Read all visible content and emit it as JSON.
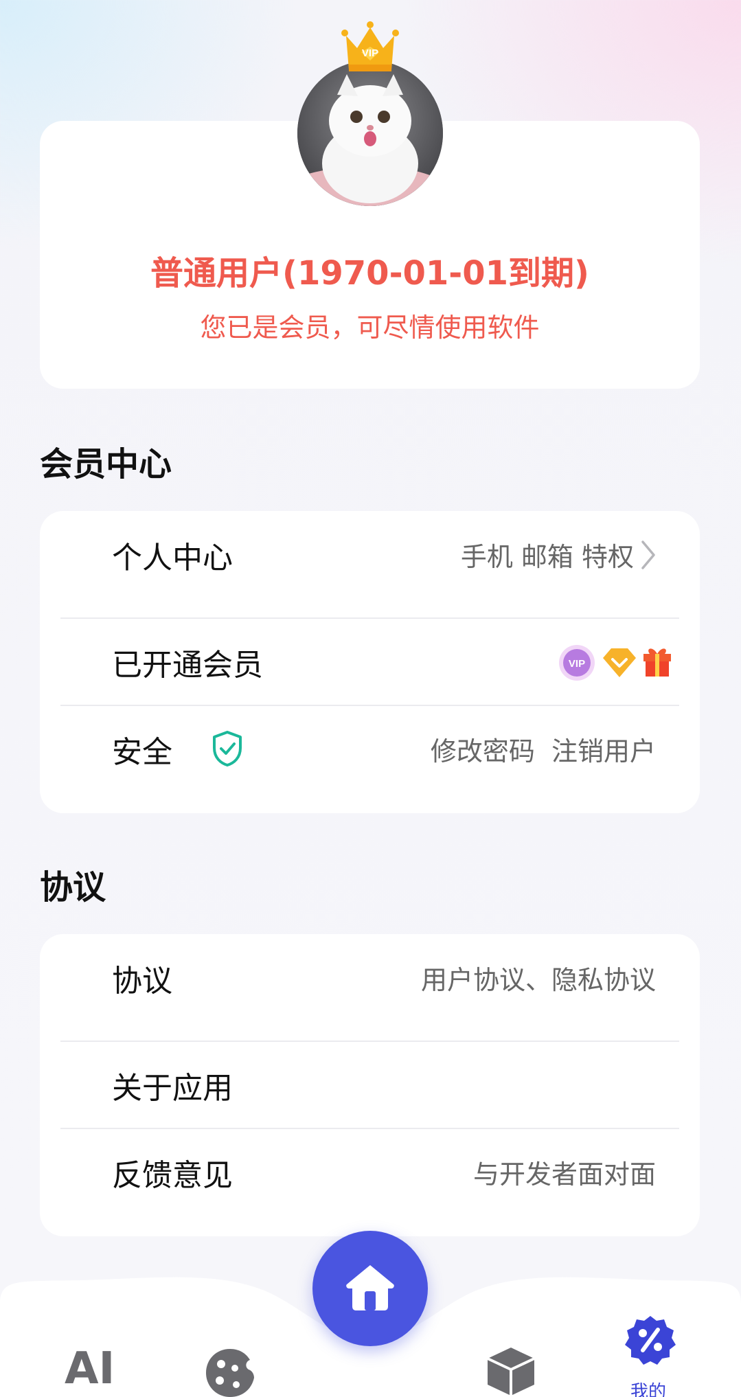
{
  "profile": {
    "status": "普通用户(1970-01-01到期)",
    "tip": "您已是会员，可尽情使用软件",
    "crown_text": "VIP"
  },
  "member_center": {
    "title": "会员中心",
    "rows": [
      {
        "label": "个人中心",
        "right": "手机 邮箱 特权"
      },
      {
        "label": "已开通会员",
        "badges": [
          "vip-badge-icon",
          "diamond-icon",
          "gift-icon"
        ],
        "vip_text": "VIP"
      },
      {
        "label": "安全",
        "right": "修改密码  注销用户"
      }
    ]
  },
  "agreement": {
    "title": "协议",
    "rows": [
      {
        "label": "协议",
        "right": "用户协议、隐私协议"
      },
      {
        "label": "关于应用",
        "right": ""
      },
      {
        "label": "反馈意见",
        "right": "与开发者面对面"
      }
    ]
  },
  "bottom_nav": {
    "items": [
      {
        "name": "AI",
        "icon": "ai-text-icon"
      },
      {
        "name": "cookie",
        "icon": "cookie-icon"
      },
      {
        "name": "home",
        "icon": "home-icon"
      },
      {
        "name": "box",
        "icon": "box-icon"
      },
      {
        "name": "我的",
        "icon": "discount-badge-icon"
      }
    ],
    "ai_label": "AI",
    "mine_label": "我的"
  },
  "colors": {
    "accent_red": "#ef5a4e",
    "nav_blue": "#4a55e0",
    "active_blue": "#3b44d6",
    "shield_green": "#1bb89a"
  }
}
